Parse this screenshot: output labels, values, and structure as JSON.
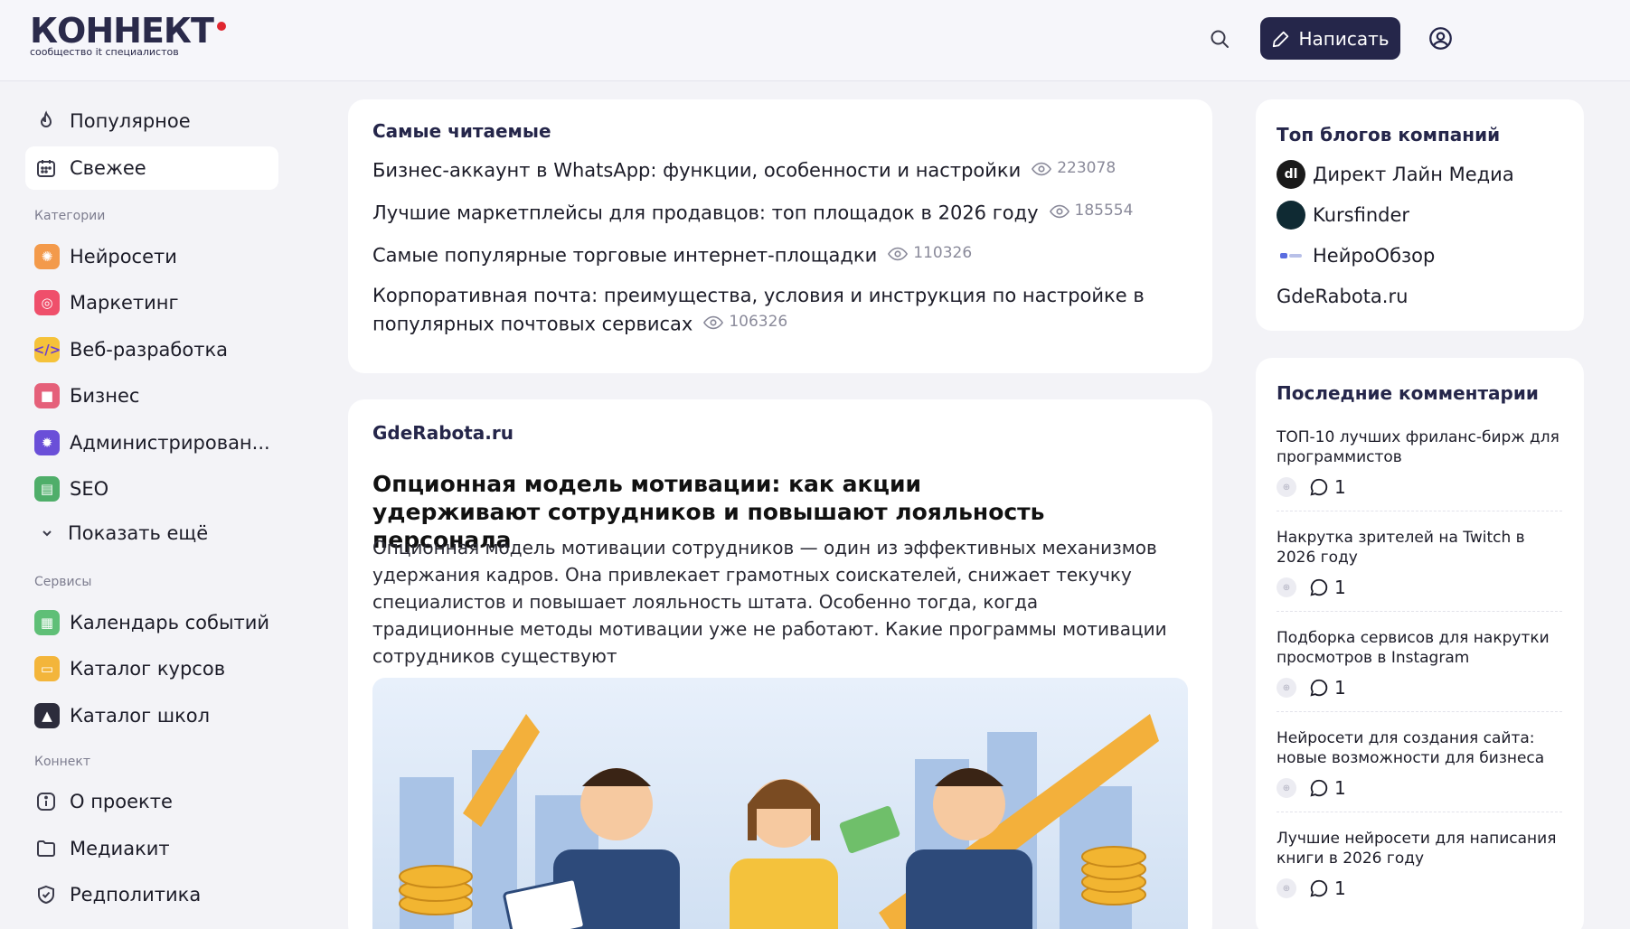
{
  "header": {
    "logo_text": "КОННЕКТ",
    "logo_sub": "сообщество it специалистов",
    "write_label": "Написать",
    "icons": {
      "search": "search-icon",
      "write": "pen-icon",
      "profile": "user-circle-icon"
    }
  },
  "sidebar": {
    "nav": [
      {
        "label": "Популярное",
        "icon": "fire-icon"
      },
      {
        "label": "Свежее",
        "icon": "calendar-icon",
        "active": true
      }
    ],
    "categories_label": "Категории",
    "categories": [
      {
        "label": "Нейросети",
        "icon": "brain-icon",
        "color": "#f39a4b"
      },
      {
        "label": "Маркетинг",
        "icon": "target-icon",
        "color": "#ef4f6b"
      },
      {
        "label": "Веб-разработка",
        "icon": "code-icon",
        "color": "#f5c23a"
      },
      {
        "label": "Бизнес",
        "icon": "briefcase-icon",
        "color": "#e5607a"
      },
      {
        "label": "Администрирован...",
        "icon": "gear-icon",
        "color": "#6a4fd8"
      },
      {
        "label": "SEO",
        "icon": "chart-icon",
        "color": "#4fae6a"
      }
    ],
    "show_more": "Показать ещё",
    "services_label": "Сервисы",
    "services": [
      {
        "label": "Календарь событий",
        "icon": "calendar-grid-icon",
        "color": "#5fbf77"
      },
      {
        "label": "Каталог курсов",
        "icon": "monitor-icon",
        "color": "#f3b53b"
      },
      {
        "label": "Каталог школ",
        "icon": "graduation-cap-icon",
        "color": "#2c2c3c"
      }
    ],
    "konnekt_label": "Коннект",
    "konnekt": [
      {
        "label": "О проекте",
        "icon": "info-icon"
      },
      {
        "label": "Медиакит",
        "icon": "folder-icon"
      },
      {
        "label": "Редполитика",
        "icon": "shield-icon"
      }
    ]
  },
  "most_read": {
    "title": "Самые читаемые",
    "items": [
      {
        "title": "Бизнес-аккаунт в WhatsApp: функции, особенности и настройки",
        "views": "223078"
      },
      {
        "title": "Лучшие маркетплейсы для продавцов: топ площадок в 2026 году",
        "views": "185554"
      },
      {
        "title": "Самые популярные торговые интернет-площадки",
        "views": "110326"
      },
      {
        "title": "Корпоративная почта: преимущества, условия и инструкция по настройке в популярных почтовых сервисах",
        "views": "106326"
      }
    ]
  },
  "article": {
    "source": "GdeRabota.ru",
    "title": "Опционная модель мотивации: как акции удерживают сотрудников и повышают лояльность персонала",
    "text": "Опционная модель мотивации сотрудников — один из эффективных механизмов удержания кадров. Она привлекает грамотных соискателей, снижает текучку специалистов и повышает лояльность штата. Особенно тогда, когда традиционные методы мотивации уже не работают. Какие программы мотивации сотрудников существуют"
  },
  "top_blogs": {
    "title": "Топ блогов компаний",
    "items": [
      {
        "name": "Директ Лайн Медиа",
        "logo_text": "dl"
      },
      {
        "name": "Kursfinder",
        "logo_text": ""
      },
      {
        "name": "НейроОбзор",
        "logo_text": ""
      },
      {
        "name": "GdeRabota.ru",
        "logo_text": ""
      }
    ]
  },
  "comments": {
    "title": "Последние комментарии",
    "items": [
      {
        "title": "ТОП-10 лучших фриланс-бирж для программистов",
        "count": "1"
      },
      {
        "title": "Накрутка зрителей на Twitch в 2026 году",
        "count": "1"
      },
      {
        "title": "Подборка сервисов для накрутки просмотров в Instagram",
        "count": "1"
      },
      {
        "title": "Нейросети для создания сайта: новые возможности для бизнеса",
        "count": "1"
      },
      {
        "title": "Лучшие нейросети для написания книги в 2026 году",
        "count": "1"
      }
    ]
  },
  "colors": {
    "brand_dark": "#25264a",
    "logo_dot": "#e0262f",
    "page_bg": "#f3f3f7"
  }
}
